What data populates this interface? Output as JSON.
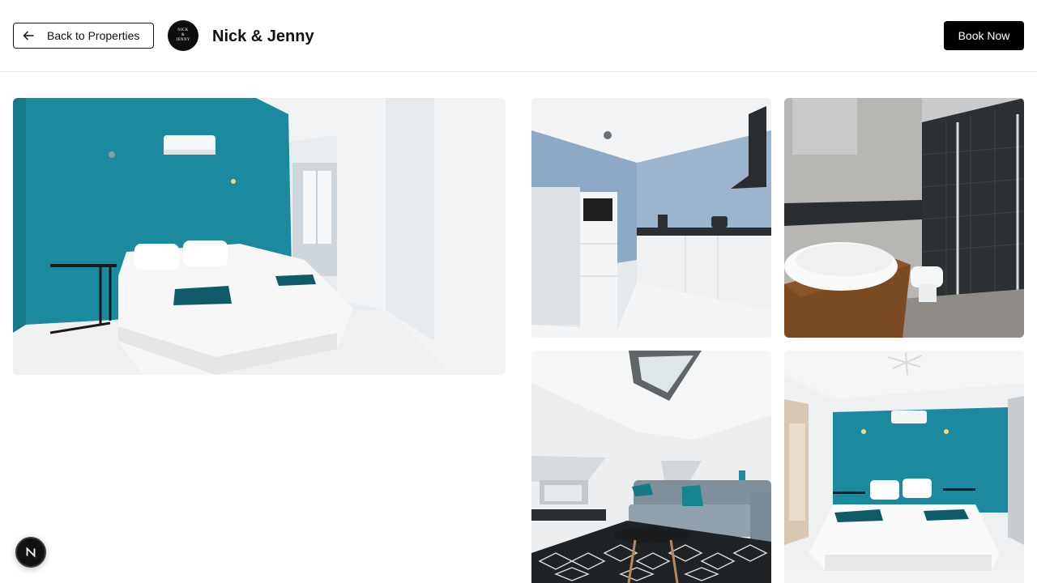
{
  "header": {
    "back_label": "Back to Properties",
    "logo_text_line1": "NICK",
    "logo_text_line2": "&",
    "logo_text_line3": "JENNY",
    "brand_name": "Nick & Jenny",
    "book_label": "Book Now"
  },
  "gallery": {
    "photos": [
      {
        "name": "bedroom-teal-wall-photo"
      },
      {
        "name": "kitchen-photo"
      },
      {
        "name": "bathroom-photo"
      },
      {
        "name": "living-room-photo"
      },
      {
        "name": "bedroom-second-photo"
      }
    ]
  },
  "dev_badge": {
    "letter": "N"
  },
  "colors": {
    "accent_teal": "#1b8a9e",
    "primary_button": "#000000",
    "border": "#e5e7eb"
  },
  "icons": [
    "arrow-left-icon",
    "brand-logo",
    "nextjs-icon"
  ]
}
